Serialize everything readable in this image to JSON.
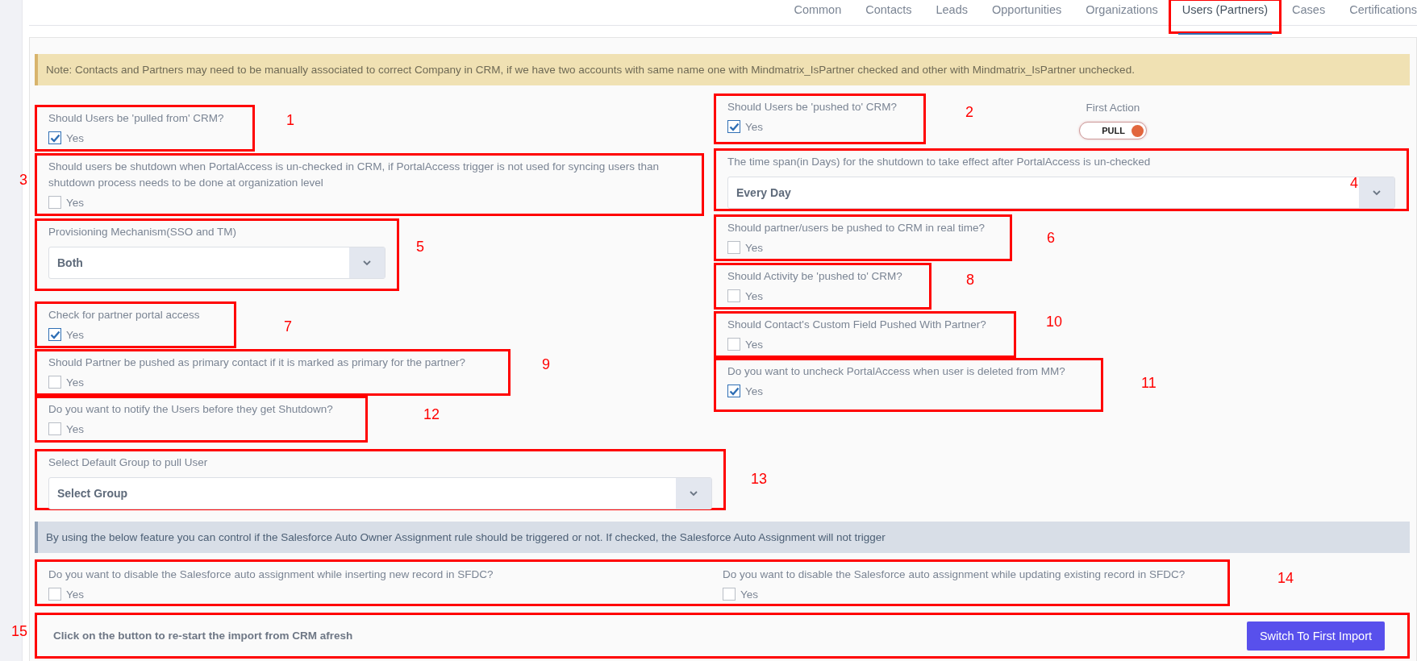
{
  "tabs": [
    {
      "label": "Common",
      "selected": false,
      "boxed": false
    },
    {
      "label": "Contacts",
      "selected": false,
      "boxed": false
    },
    {
      "label": "Leads",
      "selected": false,
      "boxed": false
    },
    {
      "label": "Opportunities",
      "selected": false,
      "boxed": false
    },
    {
      "label": "Organizations",
      "selected": false,
      "boxed": false
    },
    {
      "label": "Users (Partners)",
      "selected": true,
      "boxed": true
    },
    {
      "label": "Cases",
      "selected": false,
      "boxed": false
    },
    {
      "label": "Certifications",
      "selected": false,
      "boxed": false
    }
  ],
  "note": "Note: Contacts and Partners may need to be manually associated to correct Company in CRM, if we have two accounts with same name one with Mindmatrix_IsPartner checked and other with Mindmatrix_IsPartner unchecked.",
  "left_fields": [
    {
      "kind": "checkbox",
      "label": "Should Users be 'pulled from' CRM?",
      "option": "Yes",
      "checked": true,
      "annotation": "1"
    },
    {
      "kind": "checkbox",
      "label": "Should users be shutdown when PortalAccess is un-checked in CRM, if PortalAccess trigger is not used for syncing users than shutdown process needs to be done at organization level",
      "option": "Yes",
      "checked": false,
      "annotation": "3"
    },
    {
      "kind": "select",
      "label": "Provisioning Mechanism(SSO and TM)",
      "value": "Both",
      "annotation": "5"
    },
    {
      "kind": "checkbox",
      "label": "Check for partner portal access",
      "option": "Yes",
      "checked": true,
      "annotation": "7"
    },
    {
      "kind": "checkbox",
      "label": "Should Partner be pushed as primary contact if it is marked as primary for the partner?",
      "option": "Yes",
      "checked": false,
      "annotation": "9"
    },
    {
      "kind": "checkbox",
      "label": "Do you want to notify the Users before they get Shutdown?",
      "option": "Yes",
      "checked": false,
      "annotation": "12"
    }
  ],
  "first_action": {
    "label": "First Action",
    "toggle_text": "PULL",
    "on": true
  },
  "right_fields": [
    {
      "kind": "checkbox",
      "label": "Should Users be 'pushed to' CRM?",
      "option": "Yes",
      "checked": true,
      "annotation": "2"
    },
    {
      "kind": "select",
      "label": "The time span(in Days) for the shutdown to take effect after PortalAccess is un-checked",
      "value": "Every Day",
      "annotation": "4"
    },
    {
      "kind": "checkbox",
      "label": "Should partner/users be pushed to CRM in real time?",
      "option": "Yes",
      "checked": false,
      "annotation": "6"
    },
    {
      "kind": "checkbox",
      "label": "Should Activity be 'pushed to' CRM?",
      "option": "Yes",
      "checked": false,
      "annotation": "8"
    },
    {
      "kind": "checkbox",
      "label": "Should Contact's Custom Field Pushed With Partner?",
      "option": "Yes",
      "checked": false,
      "annotation": "10"
    },
    {
      "kind": "checkbox",
      "label": "Do you want to uncheck PortalAccess when user is deleted from MM?",
      "option": "Yes",
      "checked": true,
      "annotation": "11"
    }
  ],
  "group_field": {
    "kind": "select",
    "label": "Select Default Group to pull User",
    "value": "Select Group",
    "annotation": "13"
  },
  "assignment_info": "By using the below feature you can control if the Salesforce Auto Owner Assignment rule should be triggered or not. If checked, the Salesforce Auto Assignment will not trigger",
  "assignment": {
    "annotation": "14",
    "fields": [
      {
        "kind": "checkbox",
        "label": "Do you want to disable the Salesforce auto assignment while inserting new record in SFDC?",
        "option": "Yes",
        "checked": false
      },
      {
        "kind": "checkbox",
        "label": "Do you want to disable the Salesforce auto assignment while updating existing record in SFDC?",
        "option": "Yes",
        "checked": false
      }
    ]
  },
  "restart": {
    "annotation": "15",
    "text": "Click on the button to re-start the import from CRM afresh",
    "button": "Switch To First Import"
  }
}
